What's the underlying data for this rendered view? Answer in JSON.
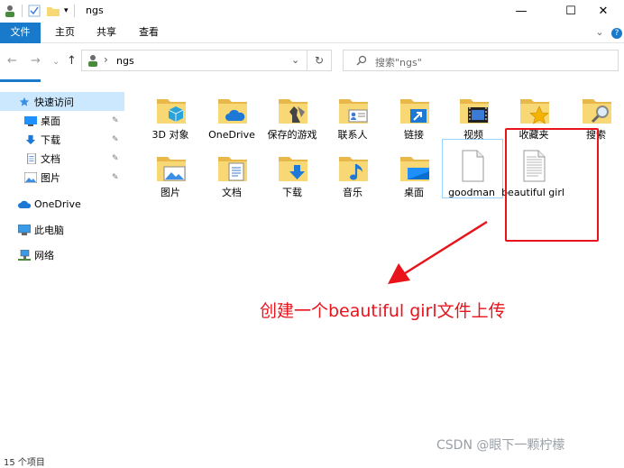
{
  "window": {
    "title": "ngs",
    "minimize": "—",
    "maximize": "☐",
    "close": "✕"
  },
  "ribbon": {
    "tabs": [
      "文件",
      "主页",
      "共享",
      "查看"
    ],
    "expand": "⌄",
    "help": "?"
  },
  "address": {
    "path_segment": "ngs",
    "separator": "›",
    "dropdown": "⌄",
    "refresh": "↻",
    "search_placeholder": "搜索\"ngs\"",
    "back": "←",
    "forward": "→",
    "recent": "⌄",
    "up": "↑"
  },
  "sidebar": {
    "quick_access": "快速访问",
    "quick_items": [
      {
        "label": "桌面",
        "pin": "📌"
      },
      {
        "label": "下载",
        "pin": "📌"
      },
      {
        "label": "文档",
        "pin": "📌"
      },
      {
        "label": "图片",
        "pin": "📌"
      }
    ],
    "onedrive": "OneDrive",
    "this_pc": "此电脑",
    "network": "网络"
  },
  "files": [
    {
      "label": "3D 对象",
      "kind": "folder-3d-objects"
    },
    {
      "label": "OneDrive",
      "kind": "folder-onedrive"
    },
    {
      "label": "保存的游戏",
      "kind": "folder-saved-games"
    },
    {
      "label": "联系人",
      "kind": "folder-contacts"
    },
    {
      "label": "链接",
      "kind": "folder-links"
    },
    {
      "label": "视频",
      "kind": "folder-videos"
    },
    {
      "label": "收藏夹",
      "kind": "folder-favorites"
    },
    {
      "label": "搜索",
      "kind": "folder-searches"
    },
    {
      "label": "图片",
      "kind": "folder-pictures"
    },
    {
      "label": "文档",
      "kind": "folder-documents"
    },
    {
      "label": "下载",
      "kind": "folder-downloads"
    },
    {
      "label": "音乐",
      "kind": "folder-music"
    },
    {
      "label": "桌面",
      "kind": "folder-desktop"
    },
    {
      "label": "goodman",
      "kind": "file-blank"
    },
    {
      "label": "beautiful girl",
      "kind": "file-text"
    }
  ],
  "annotation": {
    "text": "创建一个beautiful girl文件上传",
    "color": "#e8131b"
  },
  "watermark": "CSDN @眼下一颗柠檬",
  "status": "15 个项目",
  "colors": {
    "accent": "#1979ca",
    "selection": "#cce8ff",
    "folder": "#f8d775"
  }
}
